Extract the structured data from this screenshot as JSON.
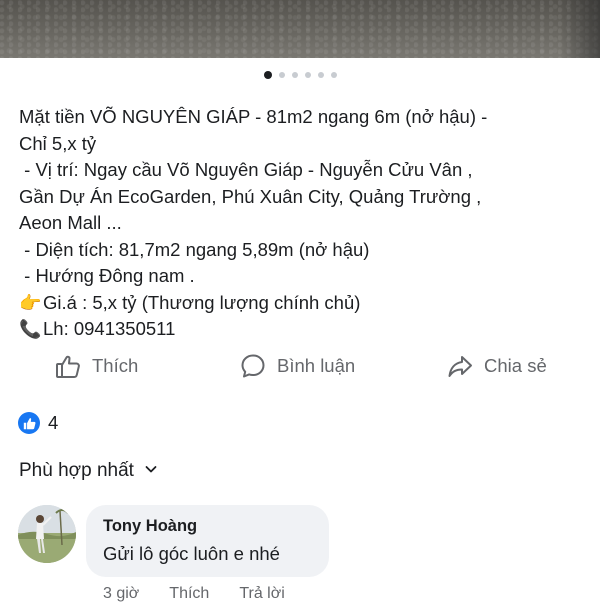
{
  "post": {
    "lines": [
      "Mặt tiền VÕ NGUYÊN GIÁP - 81m2 ngang 6m (nở hậu) -",
      "Chỉ 5,x tỷ",
      " - Vị trí: Ngay cầu Võ Nguyên Giáp - Nguyễn Cửu Vân ,",
      "Gần Dự Án EcoGarden, Phú Xuân City, Quảng Trường ,",
      "Aeon Mall ...",
      " - Diện tích: 81,7m2 ngang 5,89m (nở hậu)",
      " - Hướng Đông nam ."
    ],
    "price_line": "Gi.á : 5,x tỷ (Thương lượng chính chủ)",
    "contact_line": "Lh: 0941350511",
    "emoji_price": "👉",
    "emoji_phone": "📞"
  },
  "carousel": {
    "total": 6,
    "active_index": 1
  },
  "actions": {
    "like_label": "Thích",
    "comment_label": "Bình luận",
    "share_label": "Chia sẻ"
  },
  "reactions": {
    "count": "4",
    "icon": "like-thumb-icon"
  },
  "sort": {
    "label": "Phù hợp nhất",
    "icon": "chevron-down-icon"
  },
  "comment": {
    "author": "Tony Hoàng",
    "text": "Gửi lô góc luôn e nhé",
    "time": "3 giờ",
    "like_label": "Thích",
    "reply_label": "Trả lời"
  },
  "colors": {
    "accent": "#1877f2",
    "muted": "#65676b",
    "bubble": "#f0f2f5"
  }
}
